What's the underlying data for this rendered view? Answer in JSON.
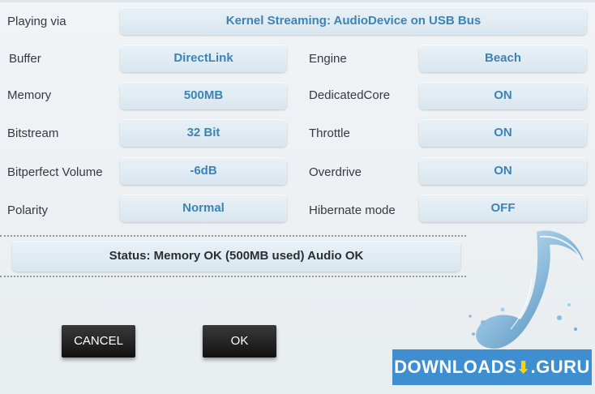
{
  "playing_via": {
    "label": "Playing via",
    "value": "Kernel Streaming: AudioDevice on USB Bus"
  },
  "rows": [
    {
      "left_label": "Buffer",
      "left_value": "DirectLink",
      "right_label": "Engine",
      "right_value": "Beach"
    },
    {
      "left_label": "Memory",
      "left_value": "500MB",
      "right_label": "DedicatedCore",
      "right_value": "ON"
    },
    {
      "left_label": "Bitstream",
      "left_value": "32 Bit",
      "right_label": "Throttle",
      "right_value": "ON"
    },
    {
      "left_label": "Bitperfect Volume",
      "left_value": "-6dB",
      "right_label": "Overdrive",
      "right_value": "ON"
    },
    {
      "left_label": "Polarity",
      "left_value": "Normal",
      "right_label": "Hibernate mode",
      "right_value": "OFF"
    }
  ],
  "status": {
    "text": "Status: Memory OK (500MB used) Audio OK"
  },
  "buttons": {
    "cancel": "CANCEL",
    "ok": "OK"
  },
  "watermark": {
    "left": "DOWNLOADS",
    "right": ".GURU"
  },
  "icons": {
    "music_note": "water-music-note-icon",
    "download_arrow": "download-arrow-icon"
  },
  "colors": {
    "value_text": "#3c84b5",
    "badge_bg": "#3f8fd0",
    "button_bg": "#1a1a1a"
  }
}
